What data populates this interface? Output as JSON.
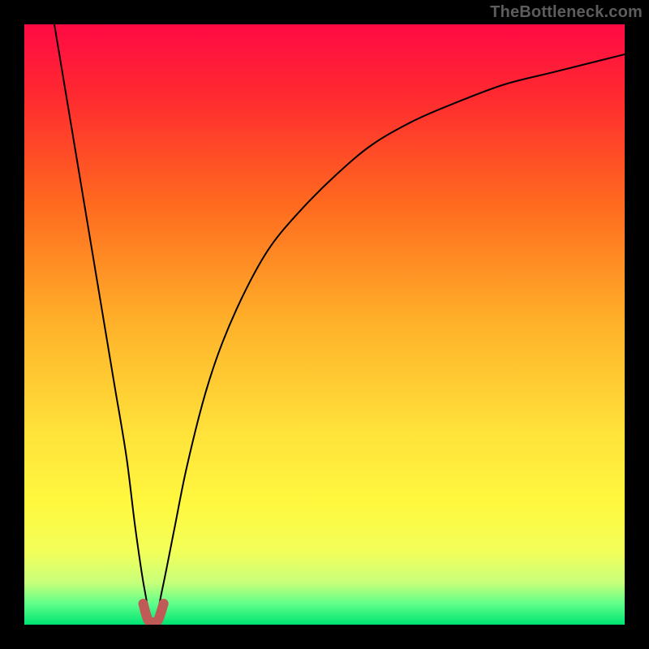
{
  "watermark": "TheBottleneck.com",
  "chart_data": {
    "type": "line",
    "title": "",
    "xlabel": "",
    "ylabel": "",
    "xlim": [
      0,
      100
    ],
    "ylim": [
      0,
      100
    ],
    "grid": false,
    "legend": false,
    "series": [
      {
        "name": "bottleneck-curve",
        "color": "#000000",
        "width": 2,
        "x": [
          5,
          7,
          9,
          11,
          13,
          15,
          17,
          18.5,
          20,
          21.5,
          23,
          25,
          27,
          30,
          33,
          37,
          41,
          46,
          52,
          58,
          65,
          72,
          80,
          88,
          96,
          100
        ],
        "y": [
          100,
          88,
          76,
          64,
          52,
          40,
          28,
          16,
          6,
          0,
          6,
          16,
          26,
          38,
          47,
          56,
          63,
          69,
          75,
          80,
          84,
          87,
          90,
          92,
          94,
          95
        ]
      },
      {
        "name": "optimal-marker",
        "color": "#c05a57",
        "width": 12,
        "cap": "round",
        "x": [
          19.8,
          20.6,
          21.5,
          22.3,
          23.2
        ],
        "y": [
          3.5,
          0.8,
          0.4,
          0.8,
          3.5
        ]
      }
    ],
    "gradient_stops": [
      {
        "offset": 0.0,
        "color": "#ff0a44"
      },
      {
        "offset": 0.12,
        "color": "#ff2a30"
      },
      {
        "offset": 0.3,
        "color": "#ff6a1f"
      },
      {
        "offset": 0.5,
        "color": "#ffb22a"
      },
      {
        "offset": 0.68,
        "color": "#ffe23a"
      },
      {
        "offset": 0.8,
        "color": "#fff83f"
      },
      {
        "offset": 0.88,
        "color": "#f2ff5a"
      },
      {
        "offset": 0.93,
        "color": "#c7ff7a"
      },
      {
        "offset": 0.965,
        "color": "#60ff8a"
      },
      {
        "offset": 1.0,
        "color": "#00e472"
      }
    ]
  }
}
